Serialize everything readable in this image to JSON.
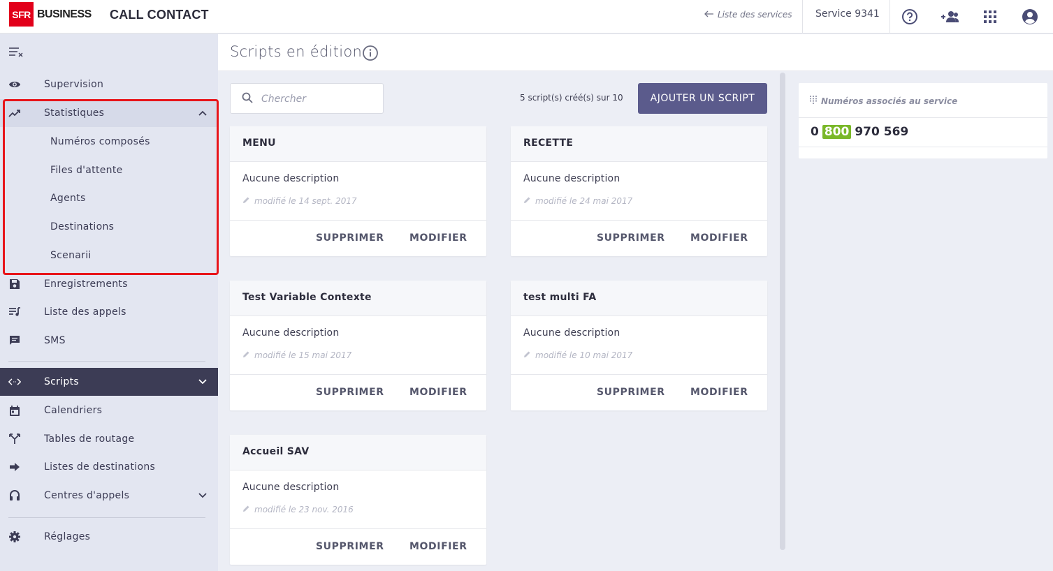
{
  "header": {
    "logo_mark": "SFR",
    "logo_text": "BUSINESS",
    "app_title": "CALL CONTACT",
    "services_link": "Liste des services",
    "service_name": "Service 9341"
  },
  "sidebar": {
    "items": [
      {
        "label": "Supervision",
        "icon": "eye-icon"
      },
      {
        "label": "Statistiques",
        "icon": "trending-up-icon"
      },
      {
        "label": "Numéros composés"
      },
      {
        "label": "Files d'attente"
      },
      {
        "label": "Agents"
      },
      {
        "label": "Destinations"
      },
      {
        "label": "Scenarii"
      },
      {
        "label": "Enregistrements",
        "icon": "save-icon"
      },
      {
        "label": "Liste des appels",
        "icon": "playlist-icon"
      },
      {
        "label": "SMS",
        "icon": "message-icon"
      },
      {
        "label": "Scripts",
        "icon": "code-icon"
      },
      {
        "label": "Calendriers",
        "icon": "calendar-icon"
      },
      {
        "label": "Tables de routage",
        "icon": "routing-icon"
      },
      {
        "label": "Listes de destinations",
        "icon": "arrow-right-icon"
      },
      {
        "label": "Centres d'appels",
        "icon": "headset-icon"
      },
      {
        "label": "Réglages",
        "icon": "gear-icon"
      }
    ]
  },
  "main": {
    "title": "Scripts en édition",
    "search_placeholder": "Chercher",
    "count_text": "5 script(s) créé(s) sur 10",
    "add_button": "AJOUTER UN SCRIPT",
    "cards": [
      {
        "title": "MENU",
        "description": "Aucune description",
        "modified": "modifié le 14 sept. 2017",
        "delete": "SUPPRIMER",
        "edit": "MODIFIER"
      },
      {
        "title": "RECETTE",
        "description": "Aucune description",
        "modified": "modifié le 24 mai 2017",
        "delete": "SUPPRIMER",
        "edit": "MODIFIER"
      },
      {
        "title": "Test Variable Contexte",
        "description": "Aucune description",
        "modified": "modifié le 15 mai 2017",
        "delete": "SUPPRIMER",
        "edit": "MODIFIER"
      },
      {
        "title": "test multi FA",
        "description": "Aucune description",
        "modified": "modifié le 10 mai 2017",
        "delete": "SUPPRIMER",
        "edit": "MODIFIER"
      },
      {
        "title": "Accueil SAV",
        "description": "Aucune description",
        "modified": "modifié le 23 nov. 2016",
        "delete": "SUPPRIMER",
        "edit": "MODIFIER"
      }
    ]
  },
  "numbers_panel": {
    "title": "Numéros associés au service",
    "number_prefix": "0",
    "number_badge": "800",
    "number_suffix": "970 569"
  },
  "colors": {
    "accent": "#5b5b8c",
    "active_nav": "#3c3c55",
    "brand_red": "#e2001a",
    "badge_green": "#7ab829",
    "highlight": "#e8151a"
  }
}
